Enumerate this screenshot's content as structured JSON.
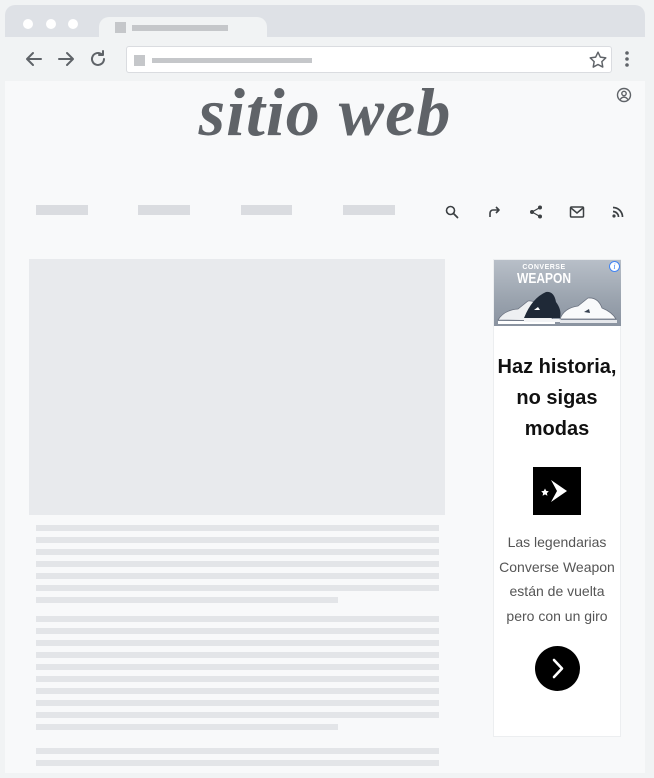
{
  "site": {
    "title": "sitio web"
  },
  "nav": {
    "icons": [
      "search-icon",
      "repost-icon",
      "share-icon",
      "mail-icon",
      "rss-icon"
    ]
  },
  "ad": {
    "brand": "CONVERSE",
    "product": "WEAPON",
    "headline": "Haz historia, no sigas modas",
    "body": "Las legendarias Converse Weapon están de vuelta pero con un giro",
    "info_label": "i",
    "cta_icon": "chevron-right-icon",
    "colors": {
      "accent": "#000000",
      "info": "#4285f4"
    }
  },
  "colors": {
    "title": "#5f6368",
    "placeholder": "#dadce0"
  }
}
